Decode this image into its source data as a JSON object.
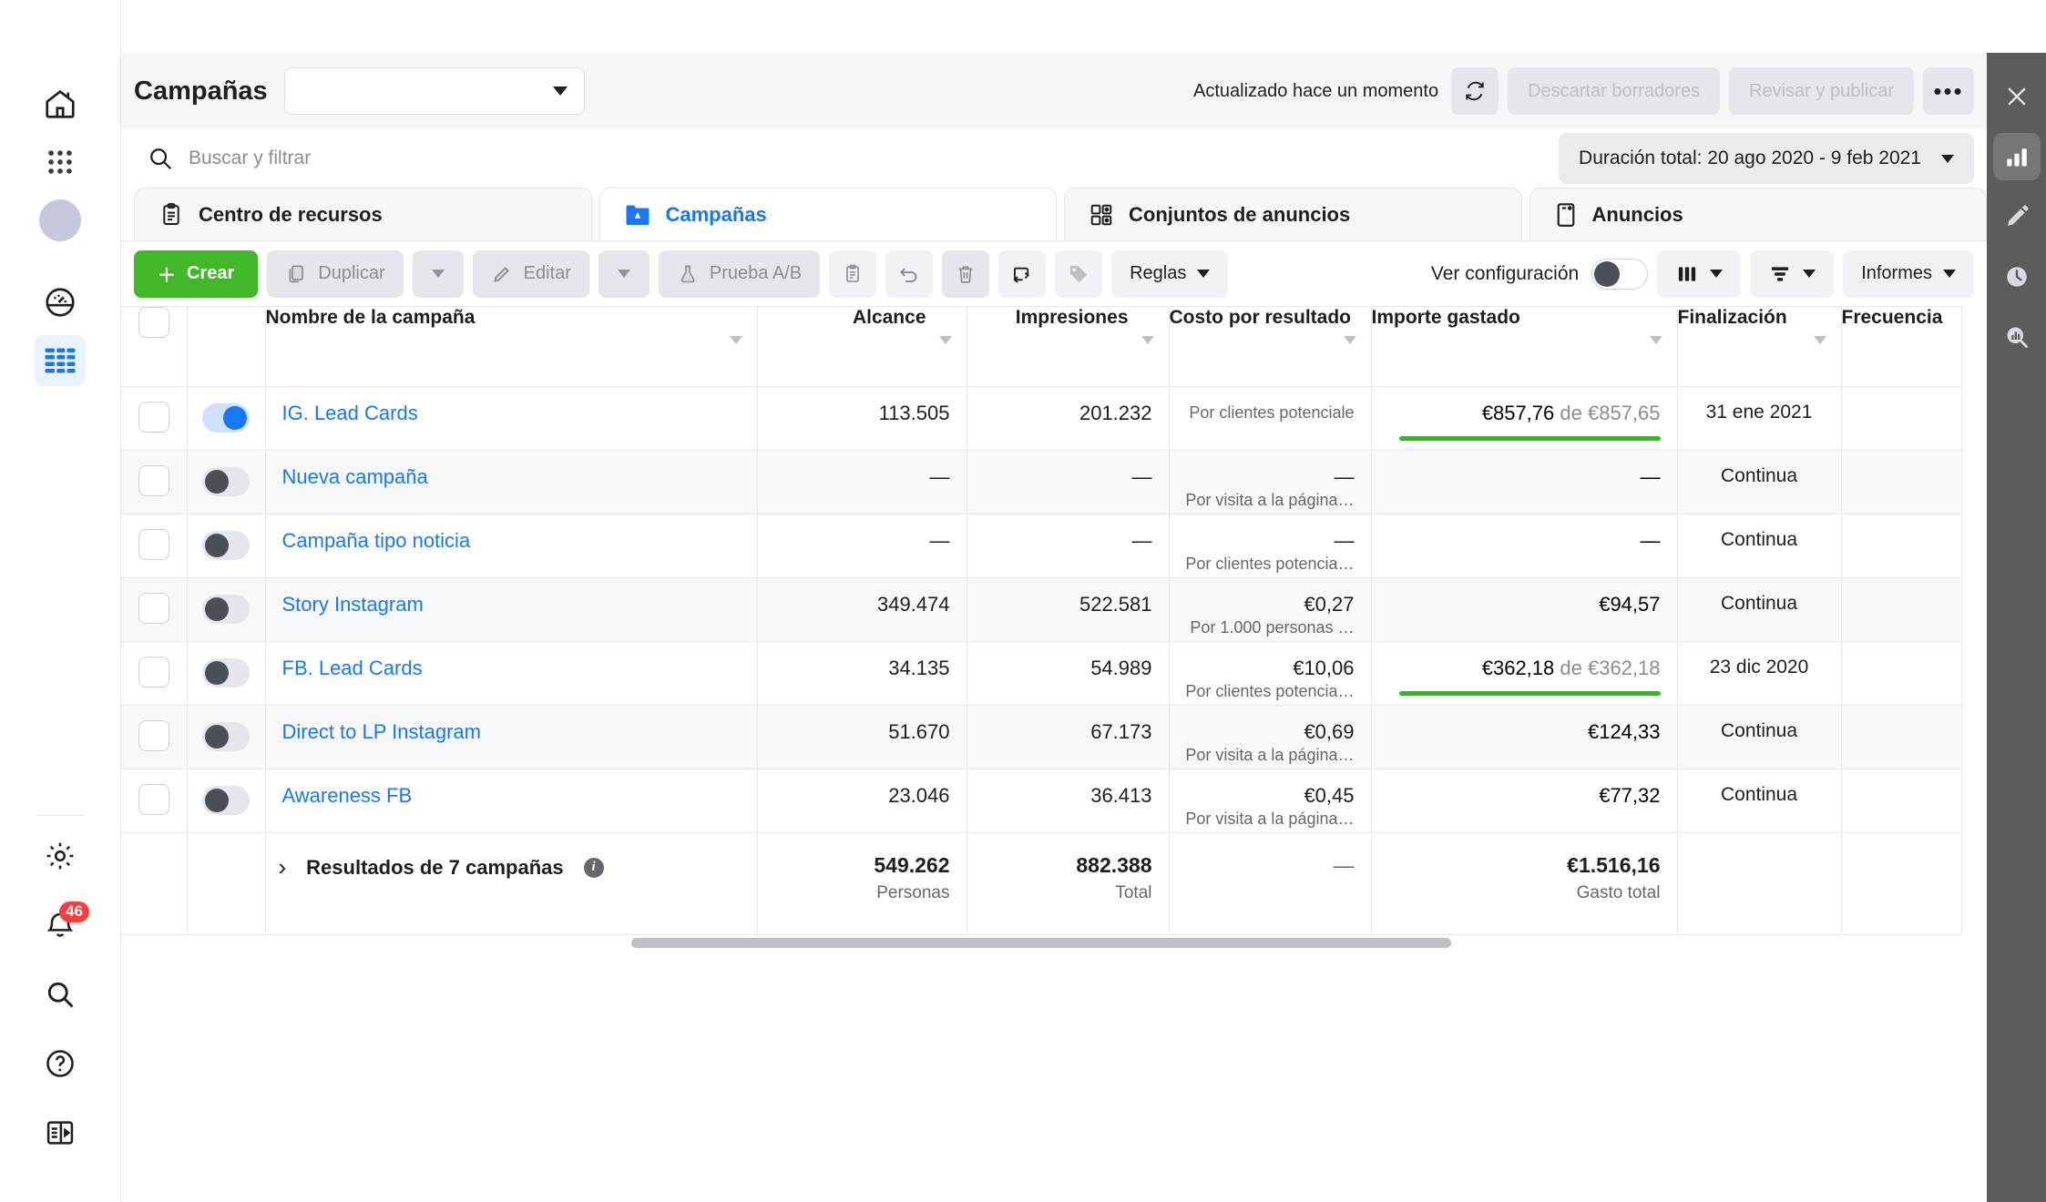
{
  "left_rail": {
    "items": [
      {
        "name": "home-icon",
        "label": "Inicio"
      },
      {
        "name": "grid-menu-icon",
        "label": "Todas las herramientas"
      },
      {
        "name": "avatar",
        "label": "Cuenta"
      },
      {
        "name": "face-gauge-icon",
        "label": "Calidad de la cuenta"
      },
      {
        "name": "table-icon",
        "label": "Administrador de anuncios"
      }
    ],
    "bottom_items": [
      {
        "name": "gear-icon",
        "label": "Configuración"
      },
      {
        "name": "bell-icon",
        "label": "Notificaciones",
        "badge": "46"
      },
      {
        "name": "search-icon",
        "label": "Buscar"
      },
      {
        "name": "help-icon",
        "label": "Ayuda"
      },
      {
        "name": "collapse-panel-icon",
        "label": "Contraer panel"
      }
    ]
  },
  "header": {
    "title": "Campañas",
    "account_select_value": "",
    "updated_text": "Actualizado hace un momento",
    "refresh_label": "↻",
    "discard_drafts_label": "Descartar borradores",
    "review_publish_label": "Revisar y publicar",
    "more_label": "•••"
  },
  "search": {
    "placeholder": "Buscar y filtrar",
    "value": "",
    "date_range_label": "Duración total: 20 ago 2020 - 9 feb 2021"
  },
  "tabs": [
    {
      "label": "Centro de recursos",
      "icon": "clipboard-icon",
      "active": false
    },
    {
      "label": "Campañas",
      "icon": "campaign-folder-icon",
      "active": true
    },
    {
      "label": "Conjuntos de anuncios",
      "icon": "adsets-grid-icon",
      "active": false
    },
    {
      "label": "Anuncios",
      "icon": "ad-card-icon",
      "active": false
    }
  ],
  "toolbar": {
    "create_label": "Crear",
    "duplicate_label": "Duplicar",
    "edit_label": "Editar",
    "ab_test_label": "Prueba A/B",
    "rules_label": "Reglas",
    "view_setup_label": "Ver configuración",
    "reports_label": "Informes",
    "icon_buttons": [
      "clipboard-icon",
      "undo-icon",
      "trash-icon",
      "export-icon",
      "tag-icon"
    ],
    "columns_icon": "columns-icon",
    "breakdown_icon": "breakdown-icon"
  },
  "table": {
    "columns": [
      "Nombre de la campaña",
      "Alcance",
      "Impresiones",
      "Costo por resultado",
      "Importe gastado",
      "Finalización",
      "Frecuencia"
    ],
    "rows": [
      {
        "name": "IG. Lead Cards",
        "toggle": "on",
        "reach": "113.505",
        "impressions": "201.232",
        "cost_per_result": "",
        "cost_sub": "Por clientes potenciale",
        "spent": "€857,76",
        "spent_of": "de €857,65",
        "has_progress": true,
        "end": "31 ene 2021"
      },
      {
        "name": "Nueva campaña",
        "toggle": "off",
        "reach": "—",
        "impressions": "—",
        "cost_per_result": "—",
        "cost_sub": "Por visita a la página…",
        "spent": "—",
        "spent_of": "",
        "has_progress": false,
        "end": "Continua"
      },
      {
        "name": "Campaña tipo noticia",
        "toggle": "off",
        "reach": "—",
        "impressions": "—",
        "cost_per_result": "—",
        "cost_sub": "Por clientes potencia…",
        "spent": "—",
        "spent_of": "",
        "has_progress": false,
        "end": "Continua"
      },
      {
        "name": "Story Instagram",
        "toggle": "off",
        "reach": "349.474",
        "impressions": "522.581",
        "cost_per_result": "€0,27",
        "cost_sub": "Por 1.000 personas …",
        "spent": "€94,57",
        "spent_of": "",
        "has_progress": false,
        "end": "Continua"
      },
      {
        "name": "FB. Lead Cards",
        "toggle": "off",
        "reach": "34.135",
        "impressions": "54.989",
        "cost_per_result": "€10,06",
        "cost_sub": "Por clientes potencia…",
        "spent": "€362,18",
        "spent_of": "de €362,18",
        "has_progress": true,
        "end": "23 dic 2020"
      },
      {
        "name": "Direct to LP Instagram",
        "toggle": "off",
        "reach": "51.670",
        "impressions": "67.173",
        "cost_per_result": "€0,69",
        "cost_sub": "Por visita a la página…",
        "spent": "€124,33",
        "spent_of": "",
        "has_progress": false,
        "end": "Continua"
      },
      {
        "name": "Awareness FB",
        "toggle": "off",
        "reach": "23.046",
        "impressions": "36.413",
        "cost_per_result": "€0,45",
        "cost_sub": "Por visita a la página…",
        "spent": "€77,32",
        "spent_of": "",
        "has_progress": false,
        "end": "Continua"
      }
    ],
    "summary": {
      "label": "Resultados de 7 campañas",
      "reach": "549.262",
      "reach_sub": "Personas",
      "impressions": "882.388",
      "impressions_sub": "Total",
      "cost_per_result": "—",
      "spent": "€1.516,16",
      "spent_sub": "Gasto total"
    }
  },
  "right_rail": {
    "items": [
      {
        "name": "close-icon",
        "label": "Cerrar",
        "selected": false
      },
      {
        "name": "bar-chart-icon",
        "label": "Gráficos",
        "selected": true
      },
      {
        "name": "pencil-icon",
        "label": "Editar",
        "selected": false
      },
      {
        "name": "clock-icon",
        "label": "Historial",
        "selected": false
      },
      {
        "name": "chart-search-icon",
        "label": "Inspeccionar",
        "selected": false
      }
    ]
  },
  "colors": {
    "brand_blue": "#1877f2",
    "create_green": "#42b72a",
    "progress_green": "#23c316",
    "badge_red": "#fa3e3e",
    "right_rail_bg": "#5c5c5c"
  }
}
